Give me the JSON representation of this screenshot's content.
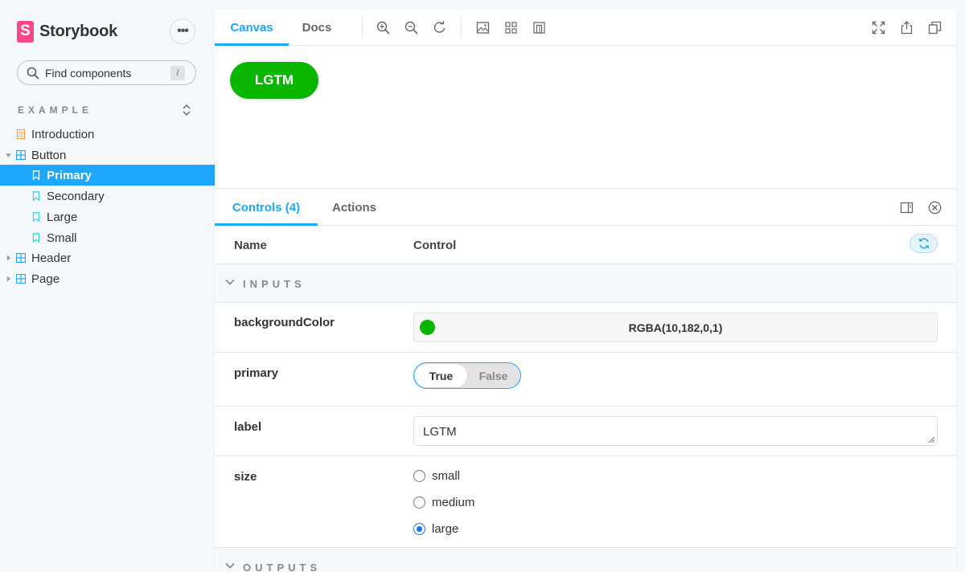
{
  "sidebar": {
    "brand": {
      "logo_letter": "S",
      "name": "Storybook"
    },
    "menu_label": "•••",
    "search": {
      "placeholder": "Find components",
      "shortcut": "/"
    },
    "section_title": "EXAMPLE",
    "items": [
      {
        "label": "Introduction",
        "icon": "document-icon"
      },
      {
        "label": "Button",
        "icon": "component-icon",
        "expanded": true
      },
      {
        "label": "Primary",
        "icon": "bookmark-icon",
        "selected": true
      },
      {
        "label": "Secondary",
        "icon": "bookmark-icon"
      },
      {
        "label": "Large",
        "icon": "bookmark-icon"
      },
      {
        "label": "Small",
        "icon": "bookmark-icon"
      },
      {
        "label": "Header",
        "icon": "component-icon",
        "expanded": false
      },
      {
        "label": "Page",
        "icon": "component-icon",
        "expanded": false
      }
    ]
  },
  "toolbar": {
    "tabs": [
      {
        "label": "Canvas",
        "active": true
      },
      {
        "label": "Docs",
        "active": false
      }
    ],
    "icons": [
      "zoom-in-icon",
      "zoom-out-icon",
      "zoom-reset-icon",
      "background-icon",
      "grid-icon",
      "outline-icon",
      "fullscreen-icon",
      "share-icon",
      "copy-icon"
    ]
  },
  "preview": {
    "button_label": "LGTM",
    "button_color": "#0ab600"
  },
  "addons": {
    "tabs": [
      {
        "label": "Controls (4)",
        "active": true
      },
      {
        "label": "Actions",
        "active": false
      }
    ],
    "header": {
      "name": "Name",
      "control": "Control"
    },
    "groups": {
      "inputs": "INPUTS",
      "outputs": "OUTPUTS"
    },
    "controls": {
      "backgroundColor": {
        "name": "backgroundColor",
        "value": "RGBA(10,182,0,1)",
        "swatch": "#0ab600"
      },
      "primary": {
        "name": "primary",
        "true_label": "True",
        "false_label": "False",
        "value": true
      },
      "label": {
        "name": "label",
        "value": "LGTM"
      },
      "size": {
        "name": "size",
        "options": [
          "small",
          "medium",
          "large"
        ],
        "selected": "large"
      }
    }
  },
  "colors": {
    "accent": "#1ea7fd",
    "brand": "#ff4785"
  }
}
